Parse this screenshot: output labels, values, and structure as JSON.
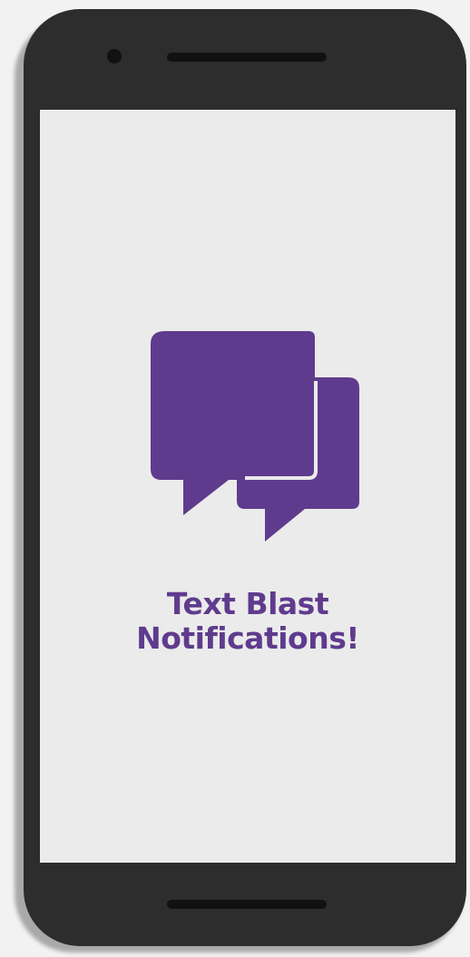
{
  "screen": {
    "icon": "double-chat-bubbles-icon",
    "title_line_1": "Text Blast",
    "title_line_2": "Notifications!"
  },
  "colors": {
    "accent": "#5f3b8d",
    "phone_body": "#2d2d2d",
    "screen_background": "#ebebeb"
  }
}
